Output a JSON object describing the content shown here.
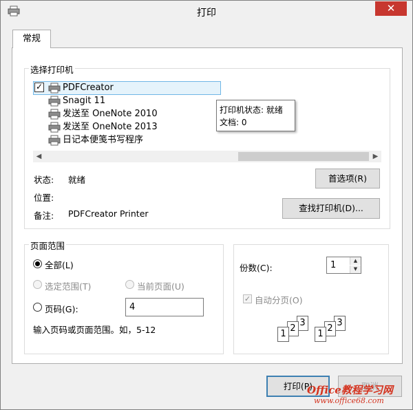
{
  "window": {
    "title": "打印",
    "close_glyph": "✕"
  },
  "tabs": [
    {
      "label": "常规"
    }
  ],
  "select_printer": {
    "group_label": "选择打印机",
    "printers": [
      {
        "name": "PDFCreator",
        "selected": true
      },
      {
        "name": "Snagit 11"
      },
      {
        "name": "发送至 OneNote 2010"
      },
      {
        "name": "发送至 OneNote 2013"
      },
      {
        "name": "日记本便笺书写程序"
      }
    ],
    "tooltip": {
      "line1": "打印机状态: 就绪",
      "line2": "文档: 0"
    },
    "status_label": "状态:",
    "status_value": "就绪",
    "location_label": "位置:",
    "location_value": "",
    "comment_label": "备注:",
    "comment_value": "PDFCreator Printer",
    "preferences_button": "首选项(R)",
    "find_printer_button": "查找打印机(D)..."
  },
  "page_range": {
    "group_label": "页面范围",
    "all_label": "全部(L)",
    "selection_label": "选定范围(T)",
    "current_page_label": "当前页面(U)",
    "pages_label": "页码(G):",
    "pages_value": "4",
    "hint": "输入页码或页面范围。如，5-12",
    "selected_option": "all"
  },
  "copies": {
    "label": "份数(C):",
    "value": "1",
    "collate_label": "自动分页(O)",
    "collate_checked": true
  },
  "footer": {
    "print_button": "打印(P)",
    "cancel_button": "取消"
  },
  "watermark": {
    "brand": "Office教程学习网",
    "url": "www.office68.com"
  },
  "colors": {
    "close": "#c7372f",
    "selection": "#e5f3fb",
    "default_button_border": "#3c7fb1",
    "watermark": "#d4331f"
  },
  "icons": {
    "title": "printer-icon",
    "printer": "printer-icon",
    "scroll_left": "chevron-left-icon",
    "scroll_right": "chevron-right-icon"
  }
}
